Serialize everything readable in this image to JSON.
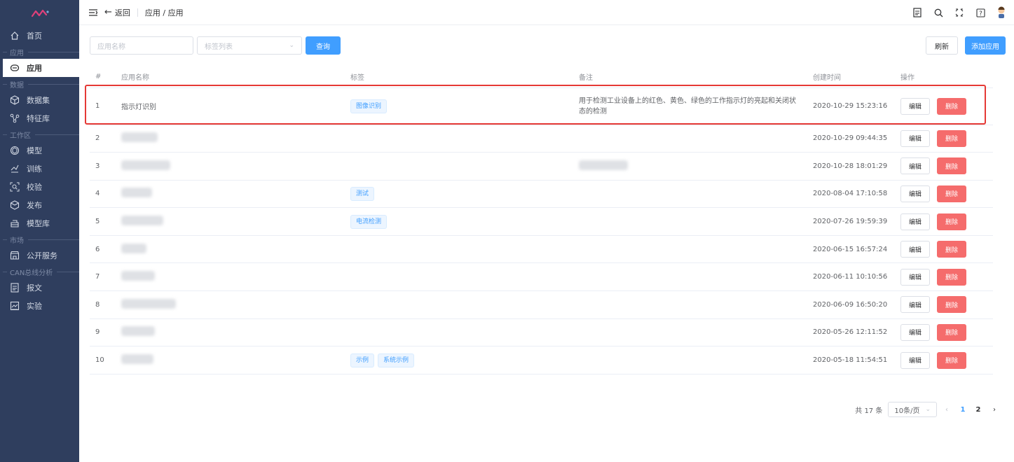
{
  "sidebar": {
    "items": [
      {
        "type": "item",
        "icon": "home-icon",
        "label": "首页"
      },
      {
        "type": "group",
        "label": "应用"
      },
      {
        "type": "item",
        "icon": "app-icon",
        "label": "应用",
        "active": true
      },
      {
        "type": "group",
        "label": "数据"
      },
      {
        "type": "item",
        "icon": "dataset-icon",
        "label": "数据集"
      },
      {
        "type": "item",
        "icon": "feature-icon",
        "label": "特征库"
      },
      {
        "type": "group",
        "label": "工作区"
      },
      {
        "type": "item",
        "icon": "model-icon",
        "label": "模型"
      },
      {
        "type": "item",
        "icon": "train-icon",
        "label": "训练"
      },
      {
        "type": "item",
        "icon": "verify-icon",
        "label": "校验"
      },
      {
        "type": "item",
        "icon": "publish-icon",
        "label": "发布"
      },
      {
        "type": "item",
        "icon": "model-lib-icon",
        "label": "模型库"
      },
      {
        "type": "group",
        "label": "市场"
      },
      {
        "type": "item",
        "icon": "store-icon",
        "label": "公开服务"
      },
      {
        "type": "group",
        "label": "CAN总线分析"
      },
      {
        "type": "item",
        "icon": "message-icon",
        "label": "报文"
      },
      {
        "type": "item",
        "icon": "experiment-icon",
        "label": "实验"
      }
    ]
  },
  "topbar": {
    "back_label": "返回",
    "breadcrumb": "应用 / 应用"
  },
  "filters": {
    "name_placeholder": "应用名称",
    "tag_placeholder": "标签列表",
    "query_label": "查询",
    "refresh_label": "刷新",
    "add_label": "添加应用"
  },
  "table": {
    "headers": [
      "#",
      "应用名称",
      "标签",
      "备注",
      "创建时间",
      "操作"
    ],
    "edit_label": "编辑",
    "delete_label": "删除",
    "rows": [
      {
        "idx": "1",
        "name": "指示灯识别",
        "tags": [
          "图像识别"
        ],
        "note": "用于检测工业设备上的红色、黄色、绿色的工作指示灯的亮起和关闭状态的检测",
        "time": "2020-10-29 15:23:16"
      },
      {
        "idx": "2",
        "name": "",
        "tags": [],
        "note": "",
        "time": "2020-10-29 09:44:35"
      },
      {
        "idx": "3",
        "name": "",
        "tags": [],
        "note": "",
        "time": "2020-10-28 18:01:29"
      },
      {
        "idx": "4",
        "name": "",
        "tags": [
          "测试"
        ],
        "note": "",
        "time": "2020-08-04 17:10:58"
      },
      {
        "idx": "5",
        "name": "",
        "tags": [
          "电流检测"
        ],
        "note": "",
        "time": "2020-07-26 19:59:39"
      },
      {
        "idx": "6",
        "name": "",
        "tags": [],
        "note": "",
        "time": "2020-06-15 16:57:24"
      },
      {
        "idx": "7",
        "name": "",
        "tags": [],
        "note": "",
        "time": "2020-06-11 10:10:56"
      },
      {
        "idx": "8",
        "name": "",
        "tags": [],
        "note": "",
        "time": "2020-06-09 16:50:20"
      },
      {
        "idx": "9",
        "name": "",
        "tags": [],
        "note": "",
        "time": "2020-05-26 12:11:52"
      },
      {
        "idx": "10",
        "name": "",
        "tags": [
          "示例",
          "系统示例"
        ],
        "note": "",
        "time": "2020-05-18 11:54:51"
      }
    ]
  },
  "pagination": {
    "total": "共 17 条",
    "page_size": "10条/页",
    "pages": [
      "1",
      "2"
    ],
    "current": "1"
  }
}
